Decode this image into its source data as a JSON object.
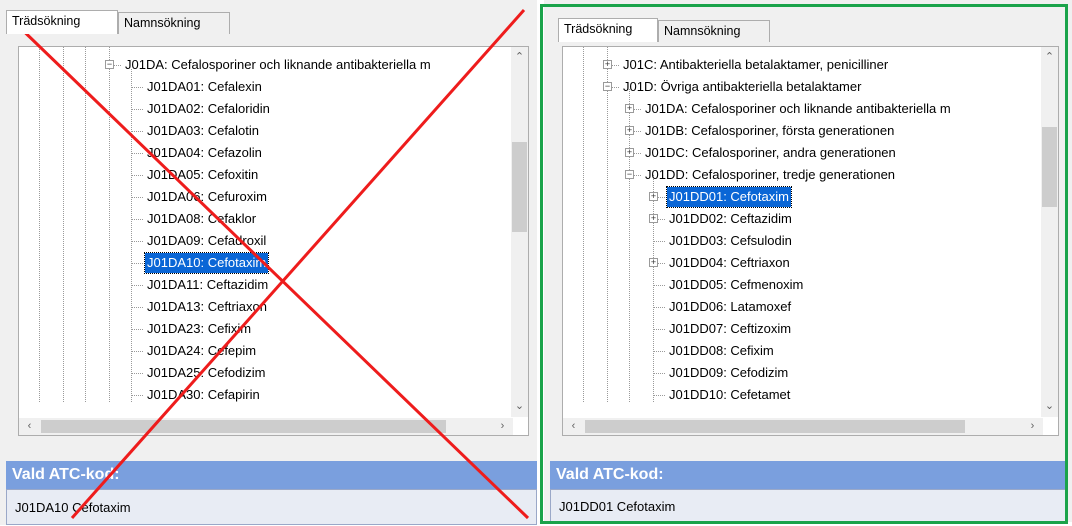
{
  "tabs": {
    "tree": "Trädsökning",
    "name": "Namnsökning"
  },
  "left_panel": {
    "status": "incorrect",
    "tree_items": [
      {
        "label": "J01DA: Cefalosporiner och liknande antibakteriella m",
        "expanded": true
      },
      {
        "label": "J01DA01: Cefalexin"
      },
      {
        "label": "J01DA02: Cefaloridin"
      },
      {
        "label": "J01DA03: Cefalotin"
      },
      {
        "label": "J01DA04: Cefazolin"
      },
      {
        "label": "J01DA05: Cefoxitin"
      },
      {
        "label": "J01DA06: Cefuroxim"
      },
      {
        "label": "J01DA08: Cefaklor"
      },
      {
        "label": "J01DA09: Cefadroxil"
      },
      {
        "label": "J01DA10: Cefotaxim",
        "selected": true
      },
      {
        "label": "J01DA11: Ceftazidim"
      },
      {
        "label": "J01DA13: Ceftriaxon"
      },
      {
        "label": "J01DA23: Cefixim"
      },
      {
        "label": "J01DA24: Cefepim"
      },
      {
        "label": "J01DA25: Cefodizim"
      },
      {
        "label": "J01DA30: Cefapirin"
      }
    ],
    "selected_header": "Vald ATC-kod:",
    "selected_value": "J01DA10 Cefotaxim"
  },
  "right_panel": {
    "status": "correct",
    "tree_items": [
      {
        "label": "J01C: Antibakteriella betalaktamer, penicilliner",
        "expandable": true
      },
      {
        "label": "J01D: Övriga antibakteriella betalaktamer",
        "expanded": true
      },
      {
        "label": "J01DA: Cefalosporiner och liknande antibakteriella m",
        "expandable": true
      },
      {
        "label": "J01DB: Cefalosporiner, första generationen",
        "expandable": true
      },
      {
        "label": "J01DC: Cefalosporiner, andra generationen",
        "expandable": true
      },
      {
        "label": "J01DD: Cefalosporiner, tredje generationen",
        "expanded": true
      },
      {
        "label": "J01DD01: Cefotaxim",
        "selected": true,
        "expandable": true
      },
      {
        "label": "J01DD02: Ceftazidim",
        "expandable": true
      },
      {
        "label": "J01DD03: Cefsulodin"
      },
      {
        "label": "J01DD04: Ceftriaxon",
        "expandable": true
      },
      {
        "label": "J01DD05: Cefmenoxim"
      },
      {
        "label": "J01DD06: Latamoxef"
      },
      {
        "label": "J01DD07: Ceftizoxim"
      },
      {
        "label": "J01DD08: Cefixim"
      },
      {
        "label": "J01DD09: Cefodizim"
      },
      {
        "label": "J01DD10: Cefetamet"
      }
    ],
    "selected_header": "Vald ATC-kod:",
    "selected_value": "J01DD01 Cefotaxim"
  },
  "colors": {
    "selection": "#0a66d6",
    "header_bar": "#7a9fde",
    "correct_frame": "#1aa34a",
    "cross": "#ee1c1c"
  },
  "icons": {
    "expand": "plus-box-icon",
    "collapse": "minus-box-icon",
    "scroll_up": "chevron-up-icon",
    "scroll_down": "chevron-down-icon",
    "scroll_left": "chevron-left-icon",
    "scroll_right": "chevron-right-icon",
    "wrong_mark": "red-x-icon"
  }
}
